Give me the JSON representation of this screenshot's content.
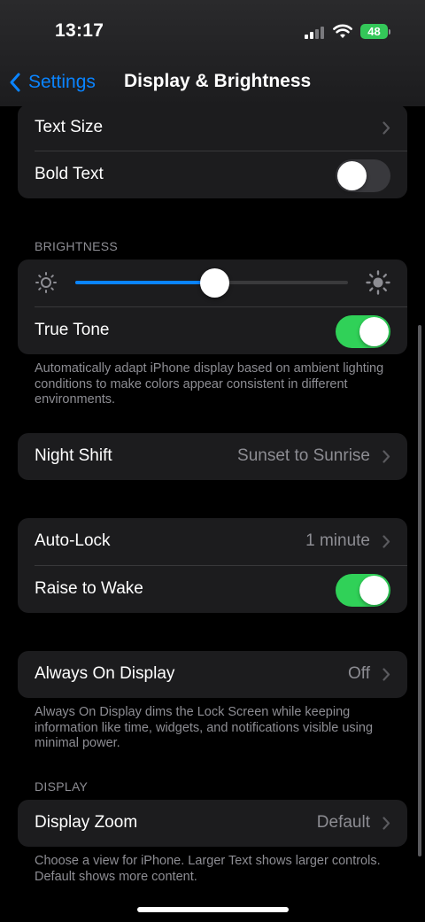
{
  "status_bar": {
    "time": "13:17",
    "battery": "48"
  },
  "nav": {
    "back_label": "Settings",
    "title": "Display & Brightness"
  },
  "text_group": {
    "text_size": "Text Size",
    "bold_text": "Bold Text",
    "bold_text_on": false
  },
  "brightness": {
    "header": "BRIGHTNESS",
    "level": 0.51,
    "true_tone": "True Tone",
    "true_tone_on": true,
    "footer": "Automatically adapt iPhone display based on ambient lighting conditions to make colors appear consistent in different environments."
  },
  "night_shift": {
    "label": "Night Shift",
    "value": "Sunset to Sunrise"
  },
  "lock_group": {
    "auto_lock": "Auto-Lock",
    "auto_lock_value": "1 minute",
    "raise_to_wake": "Raise to Wake",
    "raise_to_wake_on": true
  },
  "always_on": {
    "label": "Always On Display",
    "value": "Off",
    "footer": "Always On Display dims the Lock Screen while keeping information like time, widgets, and notifications visible using minimal power."
  },
  "display": {
    "header": "DISPLAY",
    "zoom": "Display Zoom",
    "zoom_value": "Default",
    "footer": "Choose a view for iPhone. Larger Text shows larger controls. Default shows more content."
  },
  "colors": {
    "accent": "#0a84ff",
    "toggle_on": "#30d158",
    "battery": "#34c759",
    "cell_bg": "#1c1c1e"
  }
}
